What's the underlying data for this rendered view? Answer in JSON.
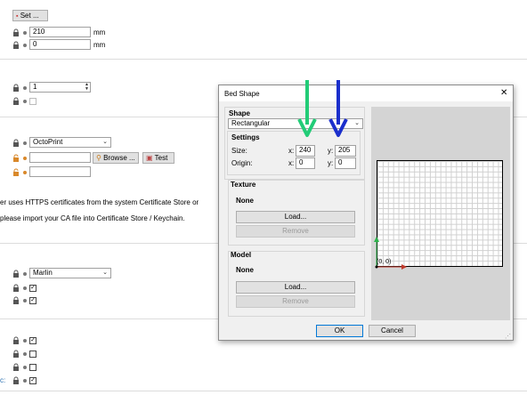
{
  "background": {
    "set_button_label": "Set ...",
    "row1_value": "210",
    "row1_unit": "mm",
    "row2_value": "0",
    "row2_unit": "mm",
    "spin_value": "1",
    "host_type_value": "OctoPrint",
    "browse_label": "Browse ...",
    "test_label": "Test",
    "cert_text_1": "er uses HTTPS certificates from the system Certificate Store or",
    "cert_text_2": "please import your CA file into Certificate Store / Keychain.",
    "gcode_flavor_value": "Marlin",
    "bottom_label_fragment": "c:"
  },
  "dialog": {
    "title": "Bed Shape",
    "close_glyph": "✕",
    "shape_group_title": "Shape",
    "shape_value": "Rectangular",
    "settings_title": "Settings",
    "size_label": "Size:",
    "origin_label": "Origin:",
    "x_label": "x:",
    "y_label": "y:",
    "size_x": "240",
    "size_y": "205",
    "origin_x": "0",
    "origin_y": "0",
    "texture_title": "Texture",
    "texture_value": "None",
    "texture_load": "Load...",
    "texture_remove": "Remove",
    "model_title": "Model",
    "model_value": "None",
    "model_load": "Load...",
    "model_remove": "Remove",
    "origin_marker": "(0, 0)",
    "ok_label": "OK",
    "cancel_label": "Cancel"
  },
  "annotations": {
    "arrow_x_color": "#22cc77",
    "arrow_y_color": "#1b2fcc"
  },
  "colors": {
    "accent_orange": "#d9882a",
    "ok_border": "#0078d7"
  }
}
